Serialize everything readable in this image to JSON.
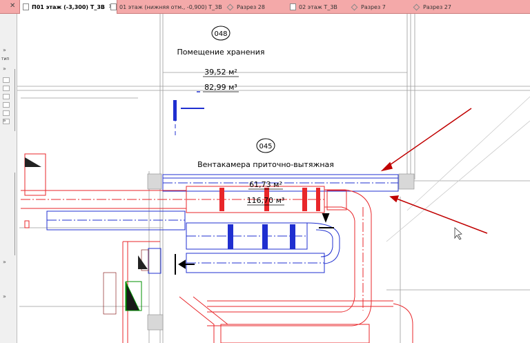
{
  "window": {
    "close_glyph": "✕"
  },
  "tabs": [
    {
      "label": "П01 этаж (-3,300) Т_3В",
      "active": true,
      "icon": "plan-view-icon",
      "close_glyph": "✕"
    },
    {
      "label": "01 этаж (нижняя отм., -0,900) Т_3В",
      "active": false,
      "icon": "plan-view-icon"
    },
    {
      "label": "Разрез 28",
      "active": false,
      "icon": "section-view-icon"
    },
    {
      "label": "02 этаж Т_3В",
      "active": false,
      "icon": "plan-view-icon"
    },
    {
      "label": "Разрез 7",
      "active": false,
      "icon": "section-view-icon"
    },
    {
      "label": "Разрез 27",
      "active": false,
      "icon": "section-view-icon"
    }
  ],
  "left_panel": {
    "type_label": "тип",
    "expand_glyph": "»"
  },
  "rooms": [
    {
      "number": "048",
      "name": "Помещение хранения",
      "area": "39,52 м²",
      "volume": "82,99 м³"
    },
    {
      "number": "045",
      "name": "Вентакамера приточно-вытяжная",
      "area": "61,73 м²",
      "volume": "116,70 м³"
    }
  ],
  "colors": {
    "tab_bar": "#f4a9a9",
    "duct_red": "#e8262a",
    "duct_blue": "#1f2fd0",
    "annotation_arrow": "#c00000",
    "grid_gray": "#9a9a9a"
  }
}
